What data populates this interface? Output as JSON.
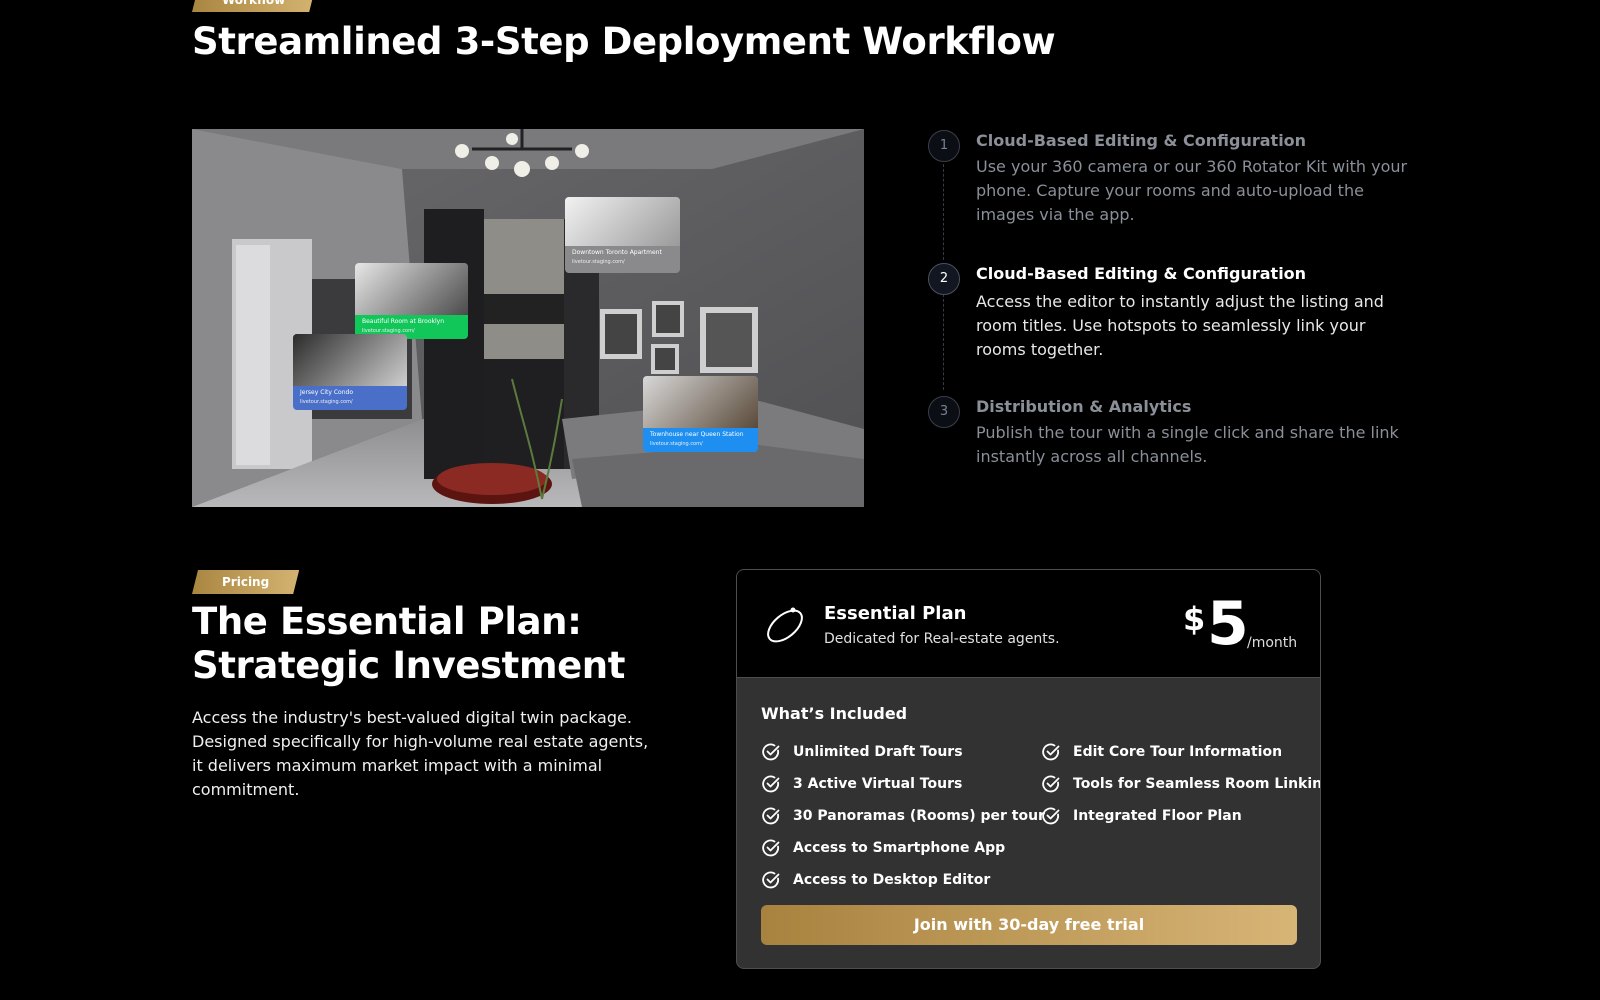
{
  "workflow": {
    "tag": "Workflow",
    "title": "Streamlined 3-Step Deployment Workflow",
    "hotspots": [
      {
        "title": "Downtown Toronto Apartment",
        "url": "livetour.staging.com/",
        "color": "#8a8a8c"
      },
      {
        "title": "Beautiful Room at Brooklyn",
        "url": "livetour.staging.com/",
        "color": "#12c759"
      },
      {
        "title": "Jersey City Condo",
        "url": "livetour.staging.com/",
        "color": "#4a6fc9"
      },
      {
        "title": "Townhouse near Queen Station",
        "url": "livetour.staging.com/",
        "color": "#1e8ff0"
      }
    ],
    "steps": [
      {
        "num": "1",
        "title": "Cloud-Based Editing & Configuration",
        "desc": "Use your 360 camera or our 360 Rotator Kit with your phone. Capture your rooms and auto-upload the images via the app.",
        "active": false
      },
      {
        "num": "2",
        "title": "Cloud-Based Editing & Configuration",
        "desc": "Access the editor to instantly adjust the listing and room titles. Use hotspots to seamlessly link your rooms together.",
        "active": true
      },
      {
        "num": "3",
        "title": "Distribution & Analytics",
        "desc": "Publish the tour with a single click and share the link instantly across all channels.",
        "active": false
      }
    ]
  },
  "pricing": {
    "tag": "Pricing",
    "title": "The Essential Plan: Strategic Investment",
    "desc": "Access the industry's best-valued digital twin package. Designed specifically for high-volume real estate agents, it delivers maximum market impact with a minimal commitment.",
    "card": {
      "icon": "ring-orbit-icon",
      "plan_name": "Essential Plan",
      "plan_sub": "Dedicated for Real-estate agents.",
      "currency": "$",
      "price": "5",
      "period": "/month",
      "included_title": "What’s Included",
      "features_left": [
        "Unlimited Draft Tours",
        "3 Active Virtual Tours",
        "30 Panoramas (Rooms) per tour",
        "Access to Smartphone App",
        "Access to Desktop Editor"
      ],
      "features_right": [
        "Edit Core Tour Information",
        "Tools for Seamless Room Linking",
        "Integrated Floor Plan"
      ],
      "cta": "Join with 30-day free trial"
    }
  }
}
